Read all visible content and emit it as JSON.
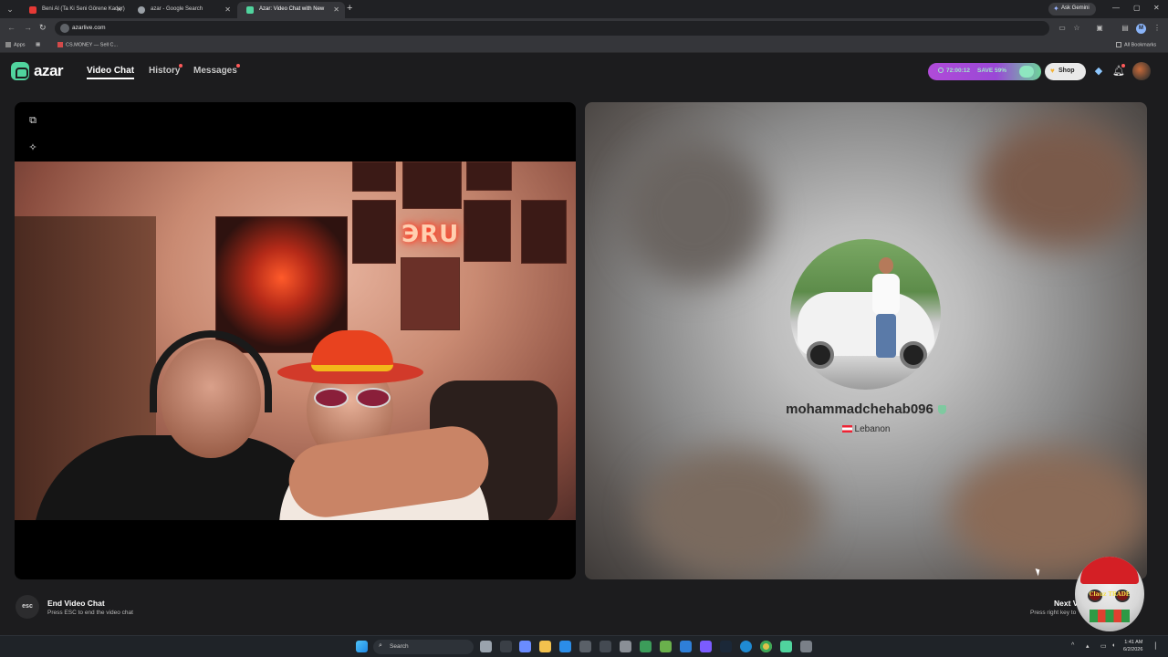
{
  "browser": {
    "tabs": [
      {
        "title": "Beni Al (Ta Ki Seni Görene Kadar)",
        "favicon_color": "#e53935",
        "active": false
      },
      {
        "title": "azar - Google Search",
        "favicon_color": "#9aa0a6",
        "active": false
      },
      {
        "title": "Azar: Video Chat with New",
        "favicon_color": "#50d49e",
        "active": true
      }
    ],
    "new_tab": "+",
    "gemini_label": "Ask Gemini",
    "url": "azarlive.com",
    "bookmarks": [
      {
        "label": "Apps",
        "icon": "apps-grid-icon"
      },
      {
        "label": "CS.MONEY — Sell C...",
        "icon": "bookmark-icon"
      }
    ],
    "all_bookmarks": "All Bookmarks",
    "profile_initial": "M"
  },
  "app": {
    "logo": "azar",
    "nav": [
      {
        "label": "Video Chat",
        "active": true,
        "has_dot": false
      },
      {
        "label": "History",
        "active": false,
        "has_dot": true
      },
      {
        "label": "Messages",
        "active": false,
        "has_dot": true
      }
    ],
    "promo": {
      "timer": "72:00:12",
      "save": "SAVE 59%"
    },
    "shop_label": "Shop",
    "accent_color": "#50d49e"
  },
  "partner": {
    "username": "mohammadchehab096",
    "country": "Lebanon"
  },
  "controls": {
    "esc_key": "esc",
    "end_title": "End Video Chat",
    "end_sub": "Press ESC to end the video chat",
    "next_title": "Next V",
    "next_sub": "Press right key to"
  },
  "stream_logo_text": "Clauz TRADE",
  "taskbar": {
    "search_placeholder": "Search",
    "time": "1:41 AM",
    "date": "6/2/2026"
  }
}
